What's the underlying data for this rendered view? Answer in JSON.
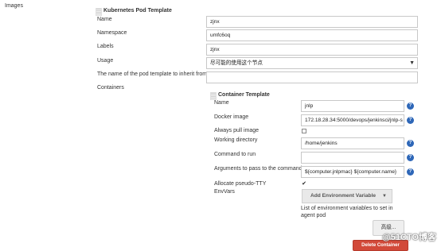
{
  "section": {
    "label": "Images"
  },
  "pod_template": {
    "header": "Kubernetes Pod Template",
    "name_label": "Name",
    "name_value": "zjnx",
    "namespace_label": "Namespace",
    "namespace_value": "umfc6oq",
    "labels_label": "Labels",
    "labels_value": "zjnx",
    "usage_label": "Usage",
    "usage_value": "尽可能的使用这个节点",
    "inherit_label": "The name of the pod template to inherit from",
    "inherit_value": "",
    "containers_label": "Containers"
  },
  "container": {
    "header": "Container Template",
    "name_label": "Name",
    "name_value": "jnlp",
    "image_label": "Docker image",
    "image_value": "172.18.28.34:5000/devops/jenkinsci/jnlp-s",
    "pull_label": "Always pull image",
    "pull_checked": false,
    "workdir_label": "Working directory",
    "workdir_value": "/home/jenkins",
    "command_label": "Command to run",
    "command_value": "",
    "args_label": "Arguments to pass to the command",
    "args_value": "${computer.jnlpmac} ${computer.name}",
    "tty_label": "Allocate pseudo-TTY",
    "tty_checked": true,
    "envvars_label": "EnvVars",
    "add_env_label": "Add Environment Variable",
    "env_hint": "List of environment variables to set in agent pod",
    "advanced_label": "高级...",
    "delete_label": "Delete Container"
  },
  "icons": {
    "help": "help-icon",
    "grip": "drag-handle-icon",
    "dropdown": "chevron-down-icon"
  },
  "colors": {
    "help": "#2e67b8",
    "delete": "#d24939",
    "button": "#e9e9e9"
  },
  "watermark": {
    "text": "@51CTO博客"
  }
}
